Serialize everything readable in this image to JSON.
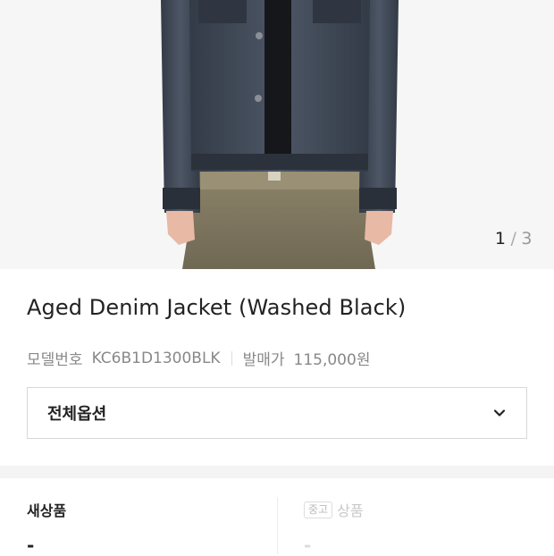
{
  "gallery": {
    "current": "1",
    "separator": "/",
    "total": "3"
  },
  "product": {
    "name": "Aged Denim Jacket (Washed Black)",
    "model_label": "모델번호",
    "model_number": "KC6B1D1300BLK",
    "release_price_label": "발매가",
    "release_price": "115,000원"
  },
  "options": {
    "selected": "전체옵션",
    "icon": "chevron-down-icon"
  },
  "conditions": {
    "new_label": "새상품",
    "new_value": "-",
    "used_tag": "중고",
    "used_label": "상품",
    "used_value": "-"
  },
  "colors": {
    "background": "#ffffff",
    "photo_background": "#f6f6f6",
    "jacket": "#3e4654",
    "pants": "#7d7560",
    "muted_text": "#888888",
    "section_band": "#f4f4f4"
  }
}
